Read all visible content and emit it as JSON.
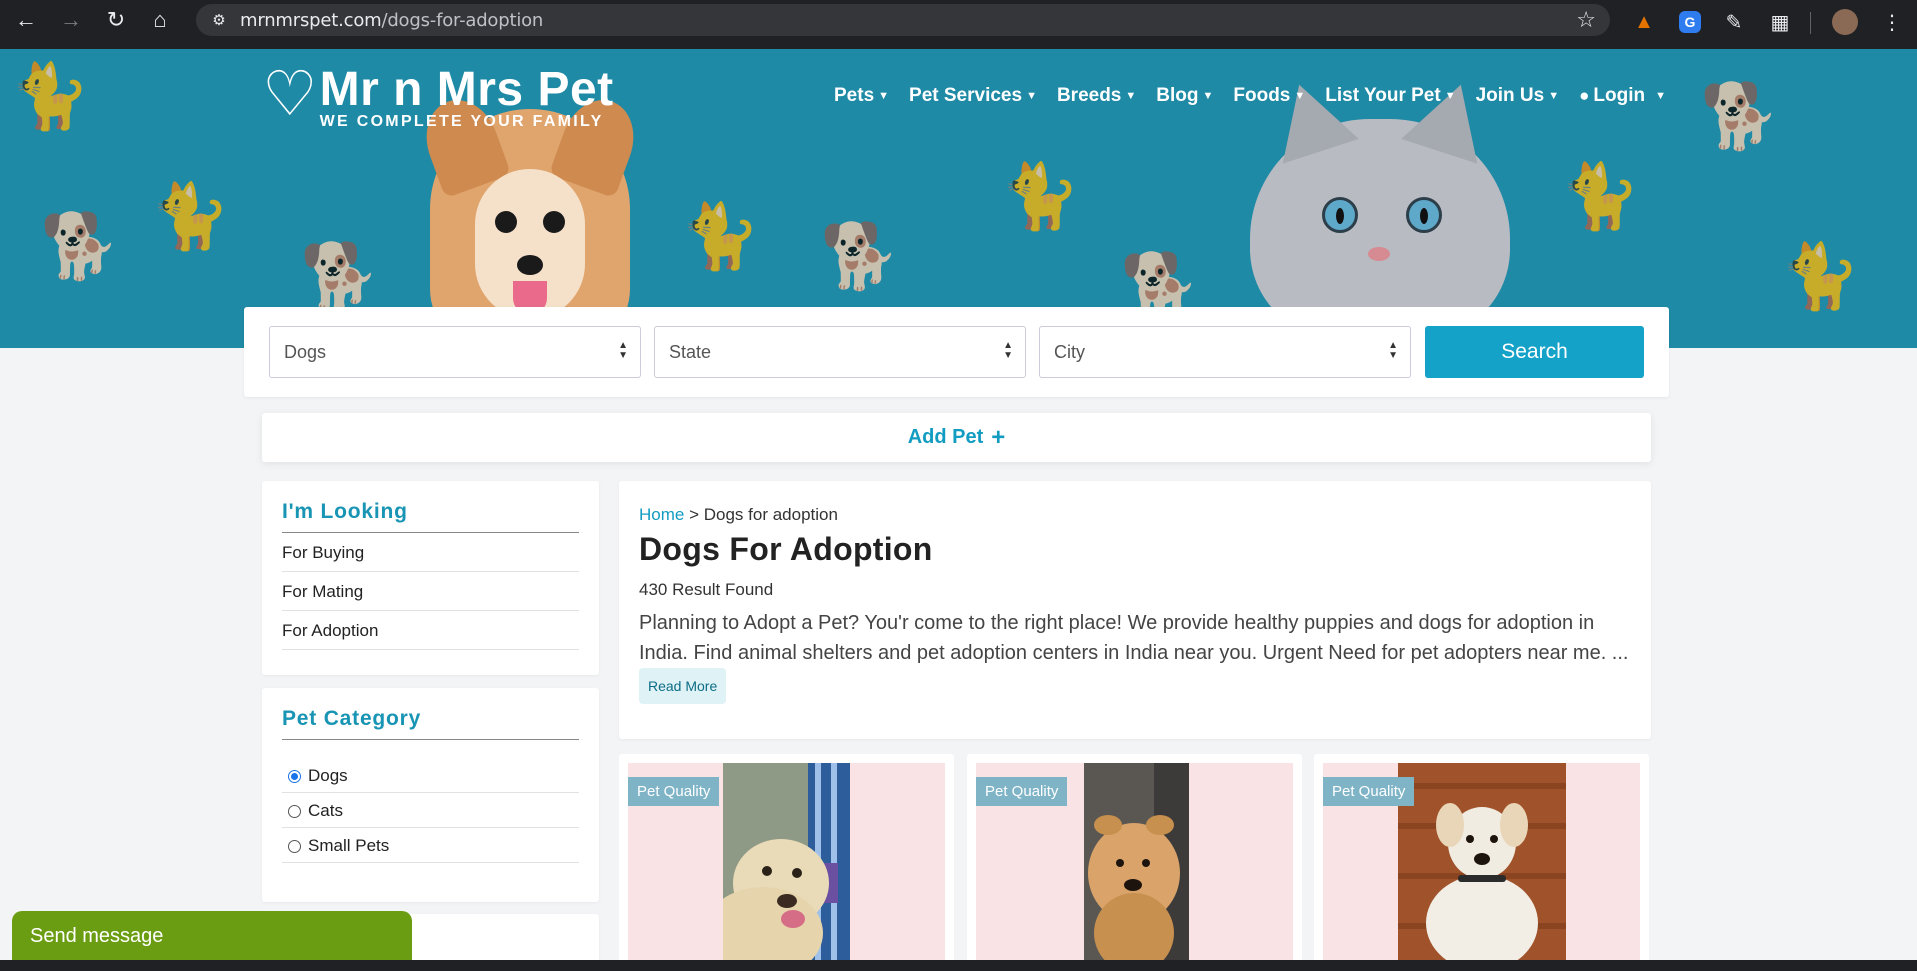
{
  "browser": {
    "url_host": "mrnmrspet.com",
    "url_path": "/dogs-for-adoption"
  },
  "site": {
    "brand": "Mr n Mrs Pet",
    "tagline": "WE COMPLETE YOUR FAMILY"
  },
  "nav": {
    "items": [
      "Pets",
      "Pet Services",
      "Breeds",
      "Blog",
      "Foods",
      "List Your Pet",
      "Join Us",
      "Login"
    ]
  },
  "search": {
    "category": "Dogs",
    "state": "State",
    "city": "City",
    "button": "Search"
  },
  "add_pet": {
    "label": "Add Pet",
    "icon": "+"
  },
  "sidebar": {
    "looking": {
      "title": "I'm Looking",
      "items": [
        "For Buying",
        "For Mating",
        "For Adoption"
      ]
    },
    "category": {
      "title": "Pet Category",
      "items": [
        "Dogs",
        "Cats",
        "Small Pets"
      ],
      "selected": "Dogs"
    }
  },
  "main": {
    "breadcrumb_home": "Home",
    "breadcrumb_sep": " > ",
    "breadcrumb_current": "Dogs for adoption",
    "title": "Dogs For Adoption",
    "result_count": "430 Result Found",
    "description": "Planning to Adopt a Pet? You'r come to the right place! We provide healthy puppies and dogs for adoption in India. Find animal shelters and pet adoption centers in India near you. Urgent Need for pet adopters near me. ...",
    "read_more": "Read More"
  },
  "cards": [
    {
      "badge": "Pet Quality"
    },
    {
      "badge": "Pet Quality"
    },
    {
      "badge": "Pet Quality"
    }
  ],
  "chat": {
    "label": "Send message"
  },
  "colors": {
    "hero": "#1f8aa5",
    "accent": "#14a2c8",
    "chat": "#6b9d12"
  }
}
